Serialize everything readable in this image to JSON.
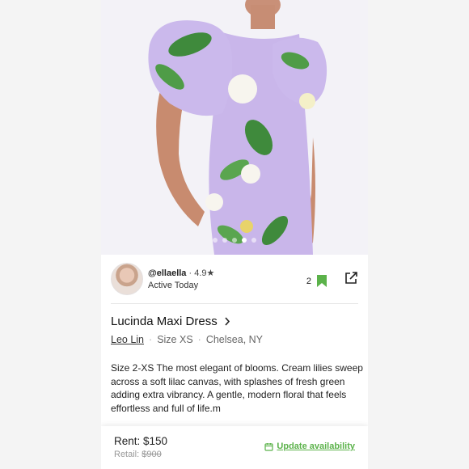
{
  "seller": {
    "handle": "@ellaella",
    "rating": "4.9",
    "rating_star": "★",
    "status": "Active Today",
    "save_count": "2"
  },
  "listing": {
    "title": "Lucinda Maxi Dress",
    "designer": "Leo Lin",
    "size": "Size XS",
    "location": "Chelsea, NY",
    "separator": "·",
    "description": "Size 2-XS The most elegant of blooms. Cream lilies sweep across a soft lilac canvas, with splashes of fresh green adding extra vibrancy. A gentle, modern floral that feels effortless and full of life.m"
  },
  "pricing": {
    "rent_label": "Rent: $150",
    "retail_label": "Retail:",
    "retail_price": "$900",
    "update_availability": "Update availability"
  },
  "carousel": {
    "total": 5,
    "active_index": 3
  },
  "colors": {
    "accent_green": "#5bb24a",
    "dress_lilac": "#c9b6ea",
    "leaf_green": "#3f8a3c"
  },
  "icons": {
    "bookmark": "bookmark-icon",
    "share": "share-icon",
    "chevron": "chevron-right-icon",
    "calendar": "calendar-icon"
  }
}
